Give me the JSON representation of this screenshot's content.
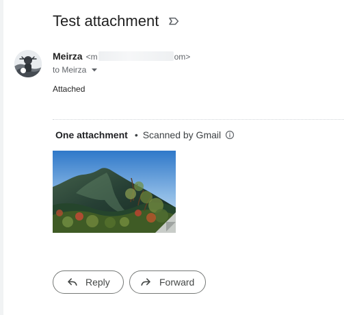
{
  "email": {
    "subject": "Test attachment",
    "sender": {
      "name": "Meirza",
      "email_start": "<m",
      "email_end": "om>"
    },
    "recipient_text": "to Meirza",
    "body": "Attached"
  },
  "attachments": {
    "count_label": "One attachment",
    "separator": "•",
    "scan_status": "Scanned by Gmail"
  },
  "actions": {
    "reply_label": "Reply",
    "forward_label": "Forward"
  },
  "icons": {
    "label": "label-outline-icon",
    "recipient_dropdown": "caret-down-icon",
    "info": "info-circle-icon",
    "reply": "reply-arrow-icon",
    "forward": "forward-arrow-icon"
  },
  "colors": {
    "text_primary": "#1f1f1f",
    "text_secondary": "#5f6368",
    "button_border": "#747775",
    "divider": "#cfd3d7"
  }
}
